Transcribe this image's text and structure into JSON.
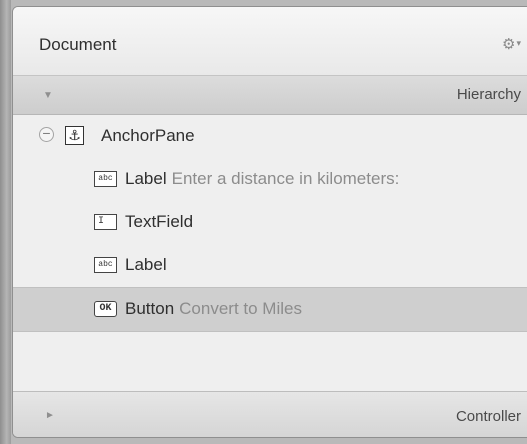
{
  "document": {
    "title": "Document",
    "gear_icon": "gear-icon"
  },
  "hierarchy": {
    "label": "Hierarchy",
    "toggle_icon": "triangle-down-icon"
  },
  "tree": {
    "root": {
      "icon": "anchor-icon",
      "label": "AnchorPane",
      "collapse_symbol": "−"
    },
    "children": [
      {
        "icon_text": "abc",
        "type": "Label",
        "detail": "Enter a distance in kilometers:"
      },
      {
        "icon_text": "I",
        "type": "TextField",
        "detail": ""
      },
      {
        "icon_text": "abc",
        "type": "Label",
        "detail": ""
      },
      {
        "icon_text": "OK",
        "type": "Button",
        "detail": "Convert to Miles",
        "selected": true
      }
    ]
  },
  "controller": {
    "label": "Controller",
    "toggle_icon": "triangle-right-icon"
  }
}
